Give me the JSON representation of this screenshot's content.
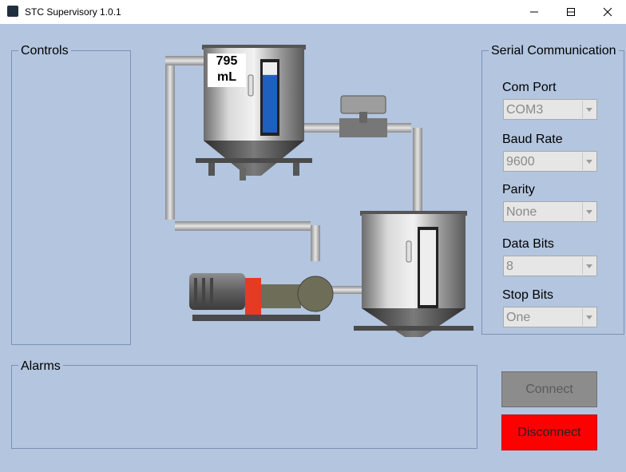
{
  "window": {
    "title": "STC Supervisory 1.0.1"
  },
  "panels": {
    "controls_label": "Controls",
    "alarms_label": "Alarms",
    "serial_label": "Serial Communication"
  },
  "tank": {
    "volume_value": "795",
    "volume_unit": "mL",
    "upper_level_fraction": 0.82,
    "lower_level_fraction": 0.0
  },
  "serial": {
    "com_port": {
      "label": "Com Port",
      "value": "COM3"
    },
    "baud_rate": {
      "label": "Baud Rate",
      "value": "9600"
    },
    "parity": {
      "label": "Parity",
      "value": "None"
    },
    "data_bits": {
      "label": "Data Bits",
      "value": "8"
    },
    "stop_bits": {
      "label": "Stop Bits",
      "value": "One"
    }
  },
  "buttons": {
    "connect": "Connect",
    "disconnect": "Disconnect"
  },
  "colors": {
    "background": "#b3c5df",
    "connect": "#8c8c8c",
    "disconnect": "#ff0000",
    "level_fill": "#1f5fbf"
  }
}
